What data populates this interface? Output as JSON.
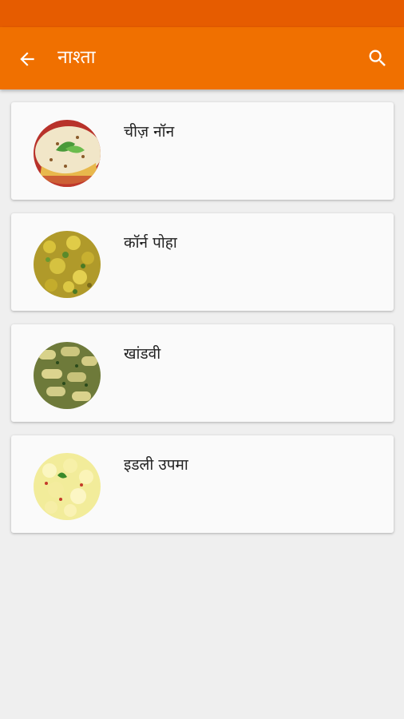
{
  "app_bar": {
    "title": "नाश्ता",
    "back_icon": "arrow-back-icon",
    "search_icon": "search-icon"
  },
  "colors": {
    "status_bar": "#e65c00",
    "app_bar": "#f07000",
    "background": "#efefef",
    "card": "#fafafa"
  },
  "items": [
    {
      "title": "चीज़ नॉन"
    },
    {
      "title": "कॉर्न पोहा"
    },
    {
      "title": "खांडवी"
    },
    {
      "title": "इडली उपमा"
    }
  ]
}
